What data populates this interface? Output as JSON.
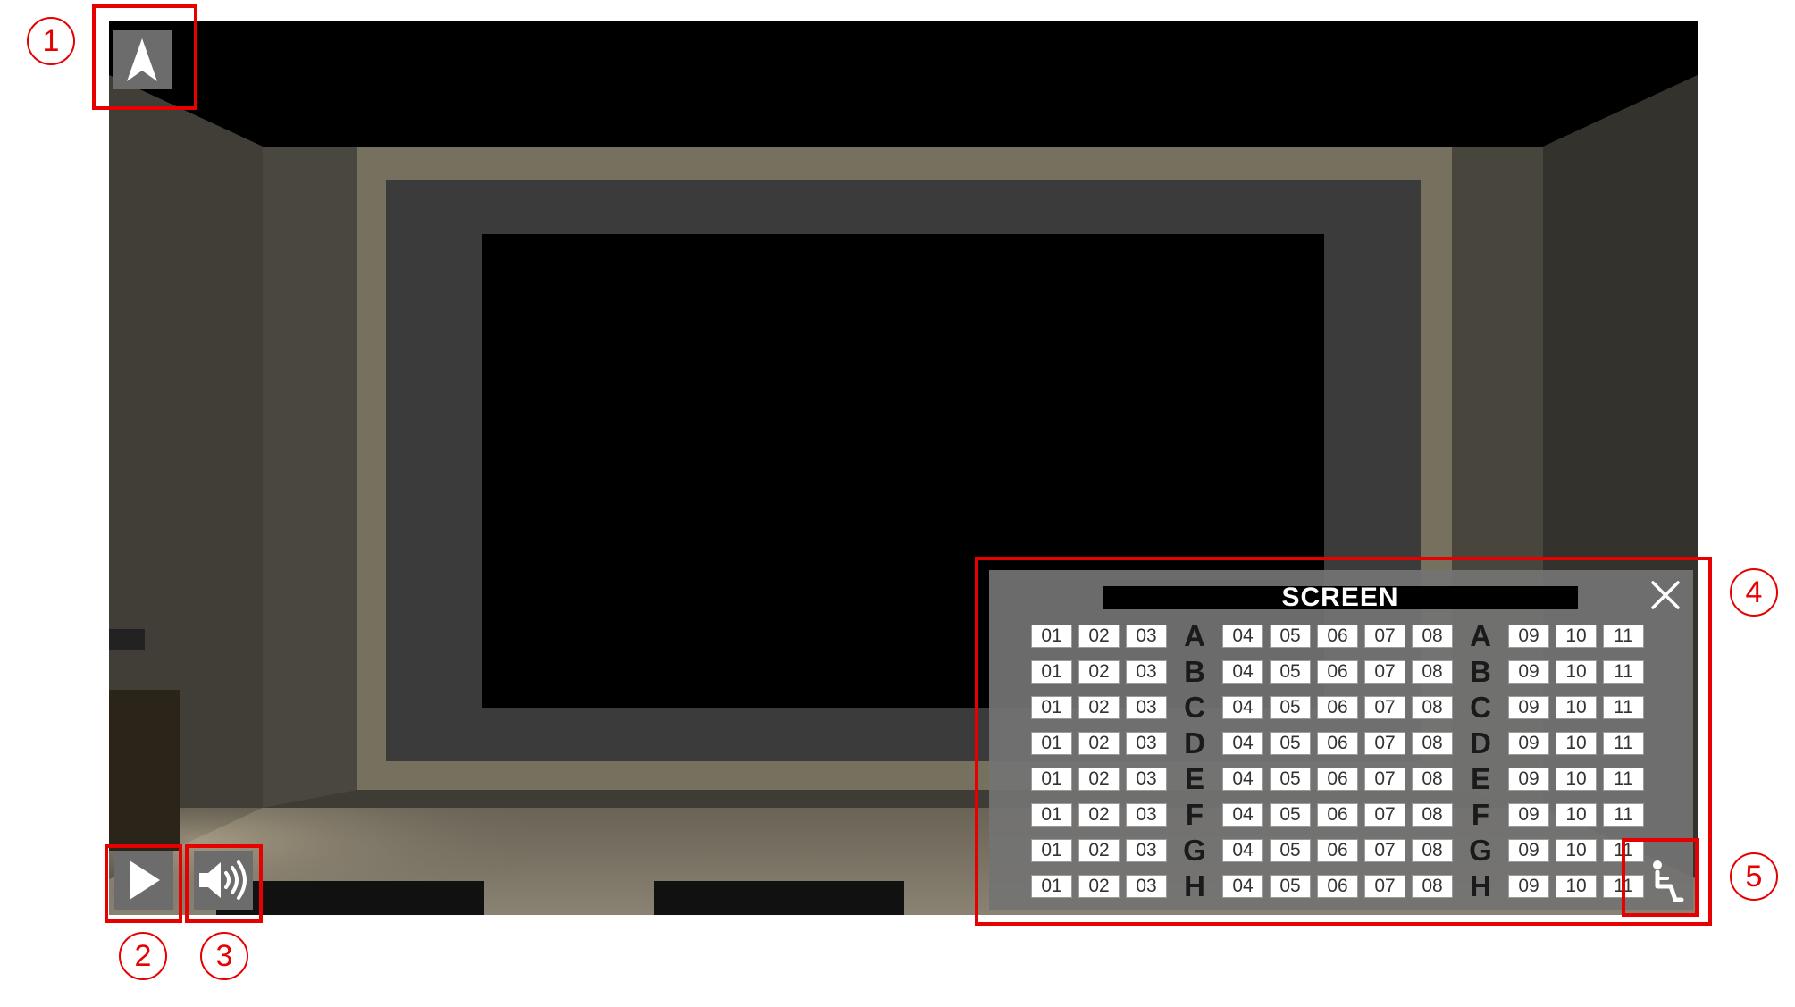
{
  "callouts": [
    "1",
    "2",
    "3",
    "4",
    "5"
  ],
  "seat_panel": {
    "screen_label": "SCREEN",
    "rows": [
      {
        "label": "A",
        "left": [
          "01",
          "02",
          "03"
        ],
        "middle": [
          "04",
          "05",
          "06",
          "07",
          "08"
        ],
        "right": [
          "09",
          "10",
          "11"
        ]
      },
      {
        "label": "B",
        "left": [
          "01",
          "02",
          "03"
        ],
        "middle": [
          "04",
          "05",
          "06",
          "07",
          "08"
        ],
        "right": [
          "09",
          "10",
          "11"
        ]
      },
      {
        "label": "C",
        "left": [
          "01",
          "02",
          "03"
        ],
        "middle": [
          "04",
          "05",
          "06",
          "07",
          "08"
        ],
        "right": [
          "09",
          "10",
          "11"
        ]
      },
      {
        "label": "D",
        "left": [
          "01",
          "02",
          "03"
        ],
        "middle": [
          "04",
          "05",
          "06",
          "07",
          "08"
        ],
        "right": [
          "09",
          "10",
          "11"
        ]
      },
      {
        "label": "E",
        "left": [
          "01",
          "02",
          "03"
        ],
        "middle": [
          "04",
          "05",
          "06",
          "07",
          "08"
        ],
        "right": [
          "09",
          "10",
          "11"
        ]
      },
      {
        "label": "F",
        "left": [
          "01",
          "02",
          "03"
        ],
        "middle": [
          "04",
          "05",
          "06",
          "07",
          "08"
        ],
        "right": [
          "09",
          "10",
          "11"
        ]
      },
      {
        "label": "G",
        "left": [
          "01",
          "02",
          "03"
        ],
        "middle": [
          "04",
          "05",
          "06",
          "07",
          "08"
        ],
        "right": [
          "09",
          "10",
          "11"
        ]
      },
      {
        "label": "H",
        "left": [
          "01",
          "02",
          "03"
        ],
        "middle": [
          "04",
          "05",
          "06",
          "07",
          "08"
        ],
        "right": [
          "09",
          "10",
          "11"
        ]
      }
    ]
  },
  "icons": {
    "compass": "compass-arrow-icon",
    "play": "play-icon",
    "volume": "volume-icon",
    "close": "close-icon",
    "wheelchair": "wheelchair-icon"
  },
  "colors": {
    "highlight": "#e60000",
    "panel": "#737373",
    "button": "#6c6c6c"
  }
}
